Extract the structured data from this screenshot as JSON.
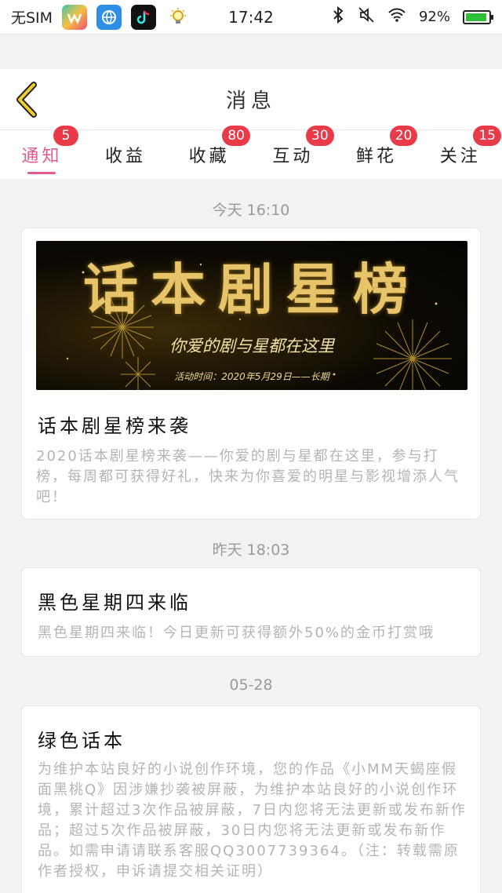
{
  "status_bar": {
    "carrier": "无SIM",
    "time": "17:42",
    "battery": "92%",
    "battery_level": 0.92,
    "icons": [
      "app-store-icon",
      "browser-icon",
      "tiktok-icon",
      "bulb-icon",
      "bluetooth-icon",
      "mute-icon",
      "wifi-icon"
    ]
  },
  "header": {
    "title": "消息"
  },
  "tabs": [
    {
      "label": "通知",
      "badge": "5",
      "active": true
    },
    {
      "label": "收益",
      "badge": ""
    },
    {
      "label": "收藏",
      "badge": "80"
    },
    {
      "label": "互动",
      "badge": "30"
    },
    {
      "label": "鲜花",
      "badge": "20"
    },
    {
      "label": "关注",
      "badge": "15"
    }
  ],
  "feed": [
    {
      "date": "今天 16:10",
      "banner": {
        "title": "话本剧星榜",
        "subtitle": "你爱的剧与星都在这里",
        "time": "活动时间：2020年5月29日——长期"
      },
      "title": "话本剧星榜来袭",
      "body": "2020话本剧星榜来袭——你爱的剧与星都在这里，参与打榜，每周都可获得好礼，快来为你喜爱的明星与影视增添人气吧！"
    },
    {
      "date": "昨天 18:03",
      "title": "黑色星期四来临",
      "body": "黑色星期四来临！今日更新可获得额外50%的金币打赏哦"
    },
    {
      "date": "05-28",
      "title": "绿色话本",
      "body": "为维护本站良好的小说创作环境，您的作品《小MM天蝎座假面黑桃Q》因涉嫌抄袭被屏蔽，为维护本站良好的小说创作环境，累计超过3次作品被屏蔽，7日内您将无法更新或发布新作品；超过5次作品被屏蔽，30日内您将无法更新或发布新作品。如需申请请联系客服QQ3007739364。（注：转载需原作者授权，申诉请提交相关证明）"
    }
  ],
  "colors": {
    "accent": "#e25d8f",
    "badge": "#e93a4a",
    "back_arrow": "#e8c02a"
  }
}
